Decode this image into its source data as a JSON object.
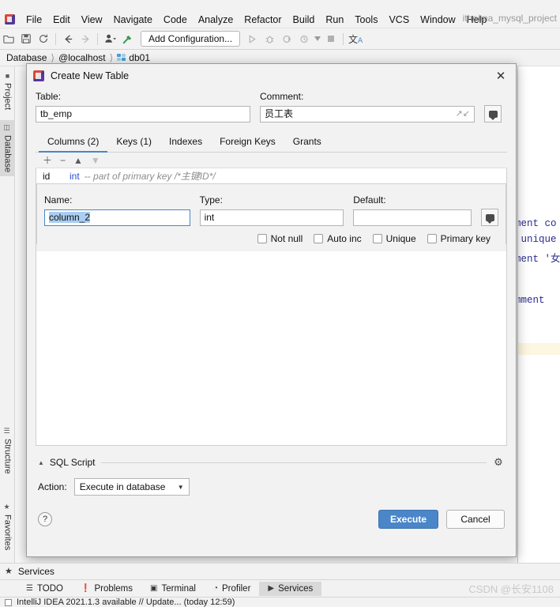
{
  "menubar": {
    "items": [
      "File",
      "Edit",
      "View",
      "Navigate",
      "Code",
      "Analyze",
      "Refactor",
      "Build",
      "Run",
      "Tools",
      "VCS",
      "Window",
      "Help"
    ],
    "project_name": "itheima_mysql_project"
  },
  "toolbar": {
    "icons": [
      "open-folder-icon",
      "save-icon",
      "sync-icon",
      "back-arrow-icon",
      "forward-arrow-icon",
      "profile-icon",
      "build-hammer-icon"
    ],
    "add_configuration": "Add Configuration...",
    "run_icons": [
      "run-icon",
      "debug-icon",
      "run-coverage-icon",
      "profile-run-icon",
      "dropdown-caret-icon",
      "stop-icon",
      "translate-icon"
    ]
  },
  "breadcrumb": {
    "root": "Database",
    "host": "@localhost",
    "database": "db01"
  },
  "sidebar": {
    "items": [
      {
        "label": "Project",
        "icon": "project-folder-icon",
        "active": false
      },
      {
        "label": "Database",
        "icon": "database-icon",
        "active": true
      },
      {
        "label": "Structure",
        "icon": "structure-icon",
        "active": false
      },
      {
        "label": "Favorites",
        "icon": "star-icon",
        "active": false
      }
    ]
  },
  "editor": {
    "code_lines": [
      "ment co",
      " unique",
      "ment '女",
      "mment"
    ]
  },
  "dialog": {
    "title": "Create New Table",
    "close_label": "✕",
    "table": {
      "label": "Table:",
      "value": "tb_emp"
    },
    "comment": {
      "label": "Comment:",
      "value": "员工表",
      "expand_icon": "expand-icon",
      "comment_button_icon": "comment-icon"
    },
    "tabs": [
      {
        "label": "Columns (2)",
        "active": true
      },
      {
        "label": "Keys (1)",
        "active": false
      },
      {
        "label": "Indexes",
        "active": false
      },
      {
        "label": "Foreign Keys",
        "active": false
      },
      {
        "label": "Grants",
        "active": false
      }
    ],
    "column_toolbar": [
      {
        "icon": "plus-icon",
        "enabled": true,
        "glyph": "＋"
      },
      {
        "icon": "minus-icon",
        "enabled": true,
        "glyph": "−"
      },
      {
        "icon": "move-up-icon",
        "enabled": true,
        "glyph": "▲"
      },
      {
        "icon": "move-down-icon",
        "enabled": false,
        "glyph": "▼"
      }
    ],
    "columns": [
      {
        "name": "id",
        "type": "int",
        "comment": "-- part of primary key /*主键ID*/"
      }
    ],
    "editor_fields": {
      "name": {
        "label": "Name:",
        "value": "column_2",
        "selected": true
      },
      "type": {
        "label": "Type:",
        "value": "int"
      },
      "default": {
        "label": "Default:",
        "value": "",
        "comment_button_icon": "comment-icon"
      }
    },
    "checkboxes": [
      {
        "label": "Not null",
        "checked": false
      },
      {
        "label": "Auto inc",
        "checked": false
      },
      {
        "label": "Unique",
        "checked": false
      },
      {
        "label": "Primary key",
        "checked": false
      }
    ],
    "sql_script": {
      "label": "SQL Script",
      "collapse_icon": "caret-up-icon",
      "settings_icon": "gear-icon",
      "action_label": "Action:",
      "action_value": "Execute in database"
    },
    "buttons": {
      "help": "?",
      "execute": "Execute",
      "cancel": "Cancel"
    }
  },
  "services_bar": {
    "label": "Services",
    "icon": "star-icon"
  },
  "bottom_tabs": [
    {
      "label": "TODO",
      "icon": "todo-icon",
      "glyph": "☰",
      "active": false
    },
    {
      "label": "Problems",
      "icon": "problems-icon",
      "glyph": "❗",
      "active": false
    },
    {
      "label": "Terminal",
      "icon": "terminal-icon",
      "glyph": "▣",
      "active": false
    },
    {
      "label": "Profiler",
      "icon": "profiler-icon",
      "glyph": "◔",
      "active": false
    },
    {
      "label": "Services",
      "icon": "services-icon",
      "glyph": "▶",
      "active": true
    }
  ],
  "watermark": "CSDN @长安1108",
  "status_bar": {
    "text": "IntelliJ IDEA 2021.1.3 available // Update...  (today 12:59)"
  },
  "colors": {
    "accent": "#4a86c8",
    "window_bg": "#f2f2f2",
    "field_border": "#b4b4b4",
    "code_blue": "#2b2b8f",
    "selection": "#aacdf0"
  }
}
